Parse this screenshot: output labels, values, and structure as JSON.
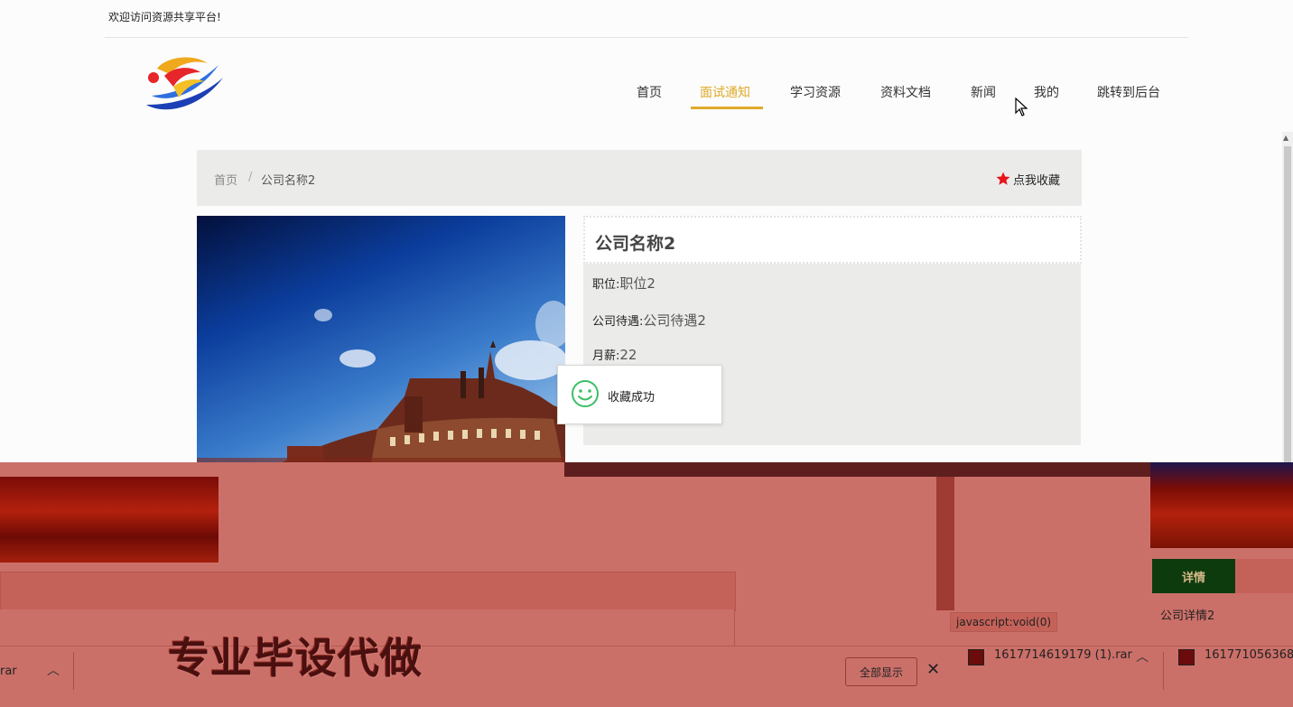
{
  "header": {
    "welcome": "欢迎访问资源共享平台!",
    "nav": [
      {
        "label": "首页",
        "active": false
      },
      {
        "label": "面试通知",
        "active": true
      },
      {
        "label": "学习资源",
        "active": false
      },
      {
        "label": "资料文档",
        "active": false
      },
      {
        "label": "新闻",
        "active": false
      },
      {
        "label": "我的",
        "active": false
      },
      {
        "label": "跳转到后台",
        "active": false
      }
    ]
  },
  "breadcrumb": {
    "home": "首页",
    "separator": "/",
    "current": "公司名称2"
  },
  "favorite": {
    "label": "点我收藏",
    "icon": "star-icon",
    "color": "#e8141b"
  },
  "company": {
    "name": "公司名称2",
    "rows": [
      {
        "label": "职位:",
        "value": "职位2"
      },
      {
        "label": "公司待遇:",
        "value": "公司待遇2"
      },
      {
        "label": "月薪:",
        "value": "22"
      }
    ]
  },
  "toast": {
    "message": "收藏成功",
    "icon": "smile-icon"
  },
  "lower": {
    "detail_tab": "详情",
    "detail_text": "公司详情2",
    "status_link": "javascript:void(0)"
  },
  "watermark": "专业毕设代做",
  "downloads": {
    "partial_left": "rar",
    "items": [
      "1617714619179 (1).rar",
      "1617710563682"
    ],
    "show_all": "全部显示"
  },
  "colors": {
    "accent": "#e0aa2b",
    "overlay": "#cb7069",
    "detail_tab": "#0d3b0d"
  }
}
